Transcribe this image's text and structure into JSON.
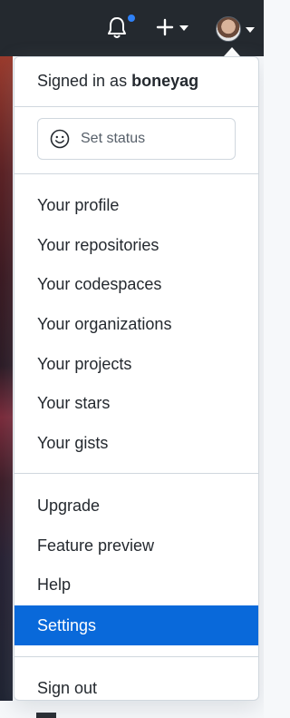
{
  "header": {
    "icons": [
      "bell-icon",
      "plus-icon",
      "caret-down-icon",
      "avatar",
      "caret-down-icon"
    ],
    "notification_color": "#2f81f7",
    "background_color": "#24292f"
  },
  "dropdown": {
    "signed_in_prefix": "Signed in as",
    "username": "boneyag",
    "status_button": {
      "icon": "smiley-icon",
      "label": "Set status"
    },
    "primary_items": [
      {
        "label": "Your profile"
      },
      {
        "label": "Your repositories"
      },
      {
        "label": "Your codespaces"
      },
      {
        "label": "Your organizations"
      },
      {
        "label": "Your projects"
      },
      {
        "label": "Your stars"
      },
      {
        "label": "Your gists"
      }
    ],
    "secondary_items": [
      {
        "label": "Upgrade",
        "active": false
      },
      {
        "label": "Feature preview",
        "active": false
      },
      {
        "label": "Help",
        "active": false
      },
      {
        "label": "Settings",
        "active": true
      }
    ],
    "sign_out_label": "Sign out",
    "active_color": "#0969da"
  }
}
